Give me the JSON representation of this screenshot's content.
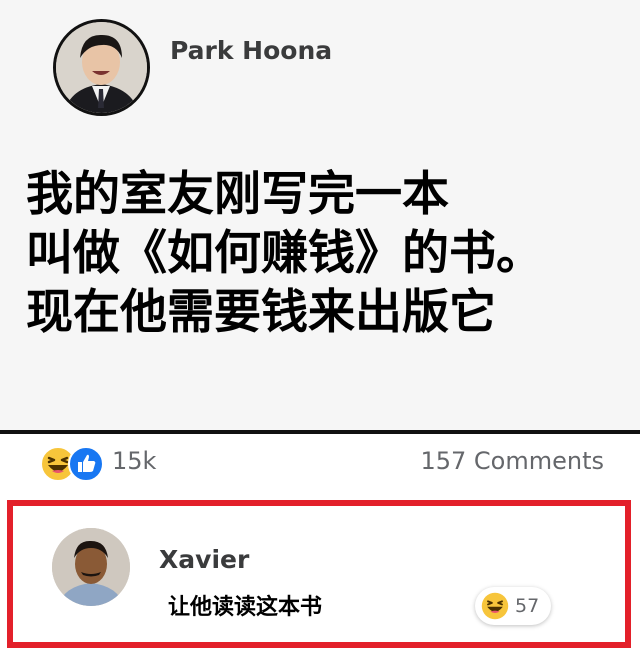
{
  "post": {
    "author_name": "Park Hoona",
    "text_lines": [
      "我的室友刚写完一本",
      "叫做《如何赚钱》的书。",
      "现在他需要钱来出版它"
    ]
  },
  "reactions": {
    "icons": [
      "laugh-react-icon",
      "like-react-icon"
    ],
    "count": "15k",
    "comments_count": "157 Comments"
  },
  "comment": {
    "author_name": "Xavier",
    "text": "让他读读这本书",
    "reaction_icon": "laugh-react-icon",
    "reaction_count": "57"
  },
  "colors": {
    "highlight_border": "#e3202a",
    "like_blue": "#1877f2",
    "laugh_yellow": "#f7c53b",
    "meta_text": "#65676b"
  }
}
